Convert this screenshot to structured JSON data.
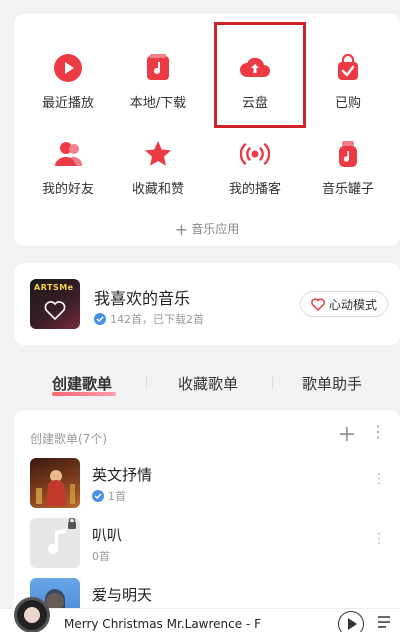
{
  "grid": {
    "items": [
      {
        "label": "最近播放",
        "icon": "play-circle-icon"
      },
      {
        "label": "本地/下载",
        "icon": "music-file-icon"
      },
      {
        "label": "云盘",
        "icon": "cloud-upload-icon"
      },
      {
        "label": "已购",
        "icon": "shopping-bag-icon"
      },
      {
        "label": "我的好友",
        "icon": "friends-icon"
      },
      {
        "label": "收藏和赞",
        "icon": "star-icon"
      },
      {
        "label": "我的播客",
        "icon": "podcast-icon"
      },
      {
        "label": "音乐罐子",
        "icon": "music-jar-icon"
      }
    ],
    "music_app": "音乐应用",
    "accent": "#ec3b45"
  },
  "favorite": {
    "cover_tag": "ARTSMe",
    "title": "我喜欢的音乐",
    "subtitle": "142首，已下载2首",
    "heart_mode": "心动模式"
  },
  "tabs": [
    "创建歌单",
    "收藏歌单",
    "歌单助手"
  ],
  "playlists": {
    "header": "创建歌单(7个)",
    "items": [
      {
        "title": "英文抒情",
        "count": "1首"
      },
      {
        "title": "叭叭",
        "count": "0首"
      },
      {
        "title": "爱与明天",
        "count": ""
      }
    ]
  },
  "player": {
    "title": "Merry Christmas Mr.Lawrence - F"
  }
}
